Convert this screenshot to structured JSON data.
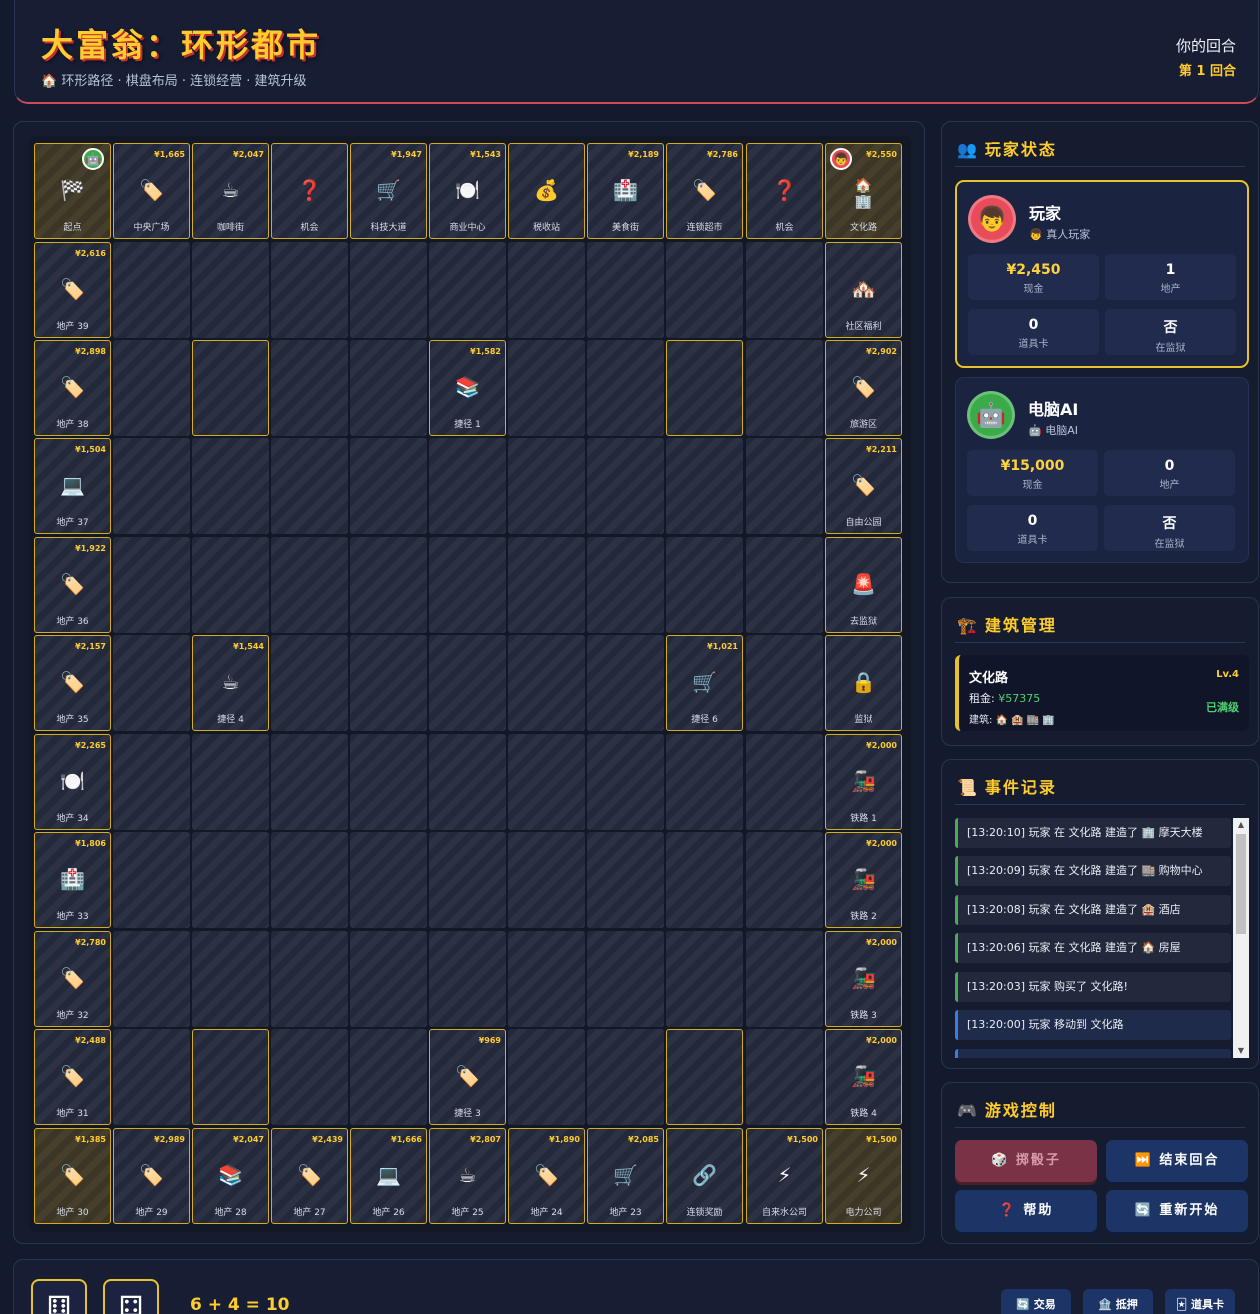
{
  "header": {
    "title": "大富翁：环形都市",
    "subtitle": "🏠 环形路径 · 棋盘布局 · 连锁经营 · 建筑升级",
    "turn_text": "你的回合",
    "round_text": "第 1 回合"
  },
  "board": {
    "top": [
      {
        "name": "起点",
        "icon": "🏁",
        "price": ""
      },
      {
        "name": "中央广场",
        "icon": "🏷️",
        "price": "¥1,665"
      },
      {
        "name": "咖啡街",
        "icon": "☕",
        "price": "¥2,047"
      },
      {
        "name": "机会",
        "icon": "❓",
        "price": ""
      },
      {
        "name": "科技大道",
        "icon": "🛒",
        "price": "¥1,947"
      },
      {
        "name": "商业中心",
        "icon": "🍽️",
        "price": "¥1,543"
      },
      {
        "name": "税收站",
        "icon": "💰",
        "price": ""
      },
      {
        "name": "美食街",
        "icon": "🏥",
        "price": "¥2,189"
      },
      {
        "name": "连锁超市",
        "icon": "🏷️",
        "price": "¥2,786"
      },
      {
        "name": "机会",
        "icon": "❓",
        "price": ""
      },
      {
        "name": "文化路",
        "icon": "🏠",
        "icon2": "🏢",
        "price": "¥2,550"
      }
    ],
    "right": [
      {
        "name": "社区福利",
        "icon": "🏘️",
        "price": ""
      },
      {
        "name": "旅游区",
        "icon": "🏷️",
        "price": "¥2,902"
      },
      {
        "name": "自由公园",
        "icon": "🏷️",
        "price": "¥2,211"
      },
      {
        "name": "去监狱",
        "icon": "🚨",
        "price": ""
      },
      {
        "name": "监狱",
        "icon": "🔒",
        "price": ""
      },
      {
        "name": "铁路 1",
        "icon": "🚂",
        "price": "¥2,000"
      },
      {
        "name": "铁路 2",
        "icon": "🚂",
        "price": "¥2,000"
      },
      {
        "name": "铁路 3",
        "icon": "🚂",
        "price": "¥2,000"
      },
      {
        "name": "铁路 4",
        "icon": "🚂",
        "price": "¥2,000"
      }
    ],
    "bottom": [
      {
        "name": "地产 30",
        "icon": "🏷️",
        "price": "¥1,385"
      },
      {
        "name": "地产 29",
        "icon": "🏷️",
        "price": "¥2,989"
      },
      {
        "name": "地产 28",
        "icon": "📚",
        "price": "¥2,047"
      },
      {
        "name": "地产 27",
        "icon": "🏷️",
        "price": "¥2,439"
      },
      {
        "name": "地产 26",
        "icon": "💻",
        "price": "¥1,666"
      },
      {
        "name": "地产 25",
        "icon": "☕",
        "price": "¥2,807"
      },
      {
        "name": "地产 24",
        "icon": "🏷️",
        "price": "¥1,890"
      },
      {
        "name": "地产 23",
        "icon": "🛒",
        "price": "¥2,085"
      },
      {
        "name": "连锁奖励",
        "icon": "🔗",
        "price": ""
      },
      {
        "name": "自来水公司",
        "icon": "⚡",
        "price": "¥1,500"
      },
      {
        "name": "电力公司",
        "icon": "⚡",
        "price": "¥1,500"
      }
    ],
    "left": [
      {
        "name": "地产 39",
        "icon": "🏷️",
        "price": "¥2,616"
      },
      {
        "name": "地产 38",
        "icon": "🏷️",
        "price": "¥2,898"
      },
      {
        "name": "地产 37",
        "icon": "💻",
        "price": "¥1,504"
      },
      {
        "name": "地产 36",
        "icon": "🏷️",
        "price": "¥1,922"
      },
      {
        "name": "地产 35",
        "icon": "🏷️",
        "price": "¥2,157"
      },
      {
        "name": "地产 34",
        "icon": "🍽️",
        "price": "¥2,265"
      },
      {
        "name": "地产 33",
        "icon": "🏥",
        "price": "¥1,806"
      },
      {
        "name": "地产 32",
        "icon": "🏷️",
        "price": "¥2,780"
      },
      {
        "name": "地产 31",
        "icon": "🏷️",
        "price": "¥2,488"
      }
    ],
    "shortcuts": [
      {
        "name": "捷径 1",
        "icon": "📚",
        "price": "¥1,582"
      },
      {
        "name": "捷径 4",
        "icon": "☕",
        "price": "¥1,544"
      },
      {
        "name": "捷径 6",
        "icon": "🛒",
        "price": "¥1,021"
      },
      {
        "name": "捷径 3",
        "icon": "🏷️",
        "price": "¥969"
      }
    ],
    "token_ai": "🤖",
    "token_human": "👦"
  },
  "players": {
    "title": "玩家状态",
    "title_icon": "👥",
    "list": [
      {
        "name": "玩家",
        "type": "👦 真人玩家",
        "avatar": "👦",
        "color": "#e84c5a",
        "cash": "¥2,450",
        "cash_label": "现金",
        "props": "1",
        "props_label": "地产",
        "cards": "0",
        "cards_label": "道具卡",
        "jail": "否",
        "jail_label": "在监狱"
      },
      {
        "name": "电脑AI",
        "type": "🤖 电脑AI",
        "avatar": "🤖",
        "color": "#3bab4a",
        "cash": "¥15,000",
        "cash_label": "现金",
        "props": "0",
        "props_label": "地产",
        "cards": "0",
        "cards_label": "道具卡",
        "jail": "否",
        "jail_label": "在监狱"
      }
    ]
  },
  "buildings": {
    "title": "建筑管理",
    "title_icon": "🏗️",
    "name": "文化路",
    "level": "Lv.4",
    "rent_label": "租金: ",
    "rent_value": "¥57375",
    "built": "建筑: 🏠 🏨 🏬 🏢",
    "status": "已满级"
  },
  "events": {
    "title": "事件记录",
    "title_icon": "📜",
    "items": [
      "[13:20:10] 玩家 在 文化路 建造了 🏢 摩天大楼",
      "[13:20:09] 玩家 在 文化路 建造了 🏬 购物中心",
      "[13:20:08] 玩家 在 文化路 建造了 🏨 酒店",
      "[13:20:06] 玩家 在 文化路 建造了 🏠 房屋",
      "[13:20:03] 玩家 购买了 文化路!",
      "[13:20:00] 玩家 移动到 文化路"
    ]
  },
  "controls": {
    "title": "游戏控制",
    "title_icon": "🎮",
    "roll": "🎲 掷骰子",
    "end_turn": "⏭️ 结束回合",
    "help": "❓ 帮助",
    "restart": "🔄 重新开始"
  },
  "dice": {
    "d1": "⚅",
    "d2": "⚃",
    "sum": "6 + 4 = 10"
  },
  "footer_buttons": {
    "trade": "🔄 交易",
    "mortgage": "🏦 抵押",
    "cards": "🃏 道具卡"
  }
}
